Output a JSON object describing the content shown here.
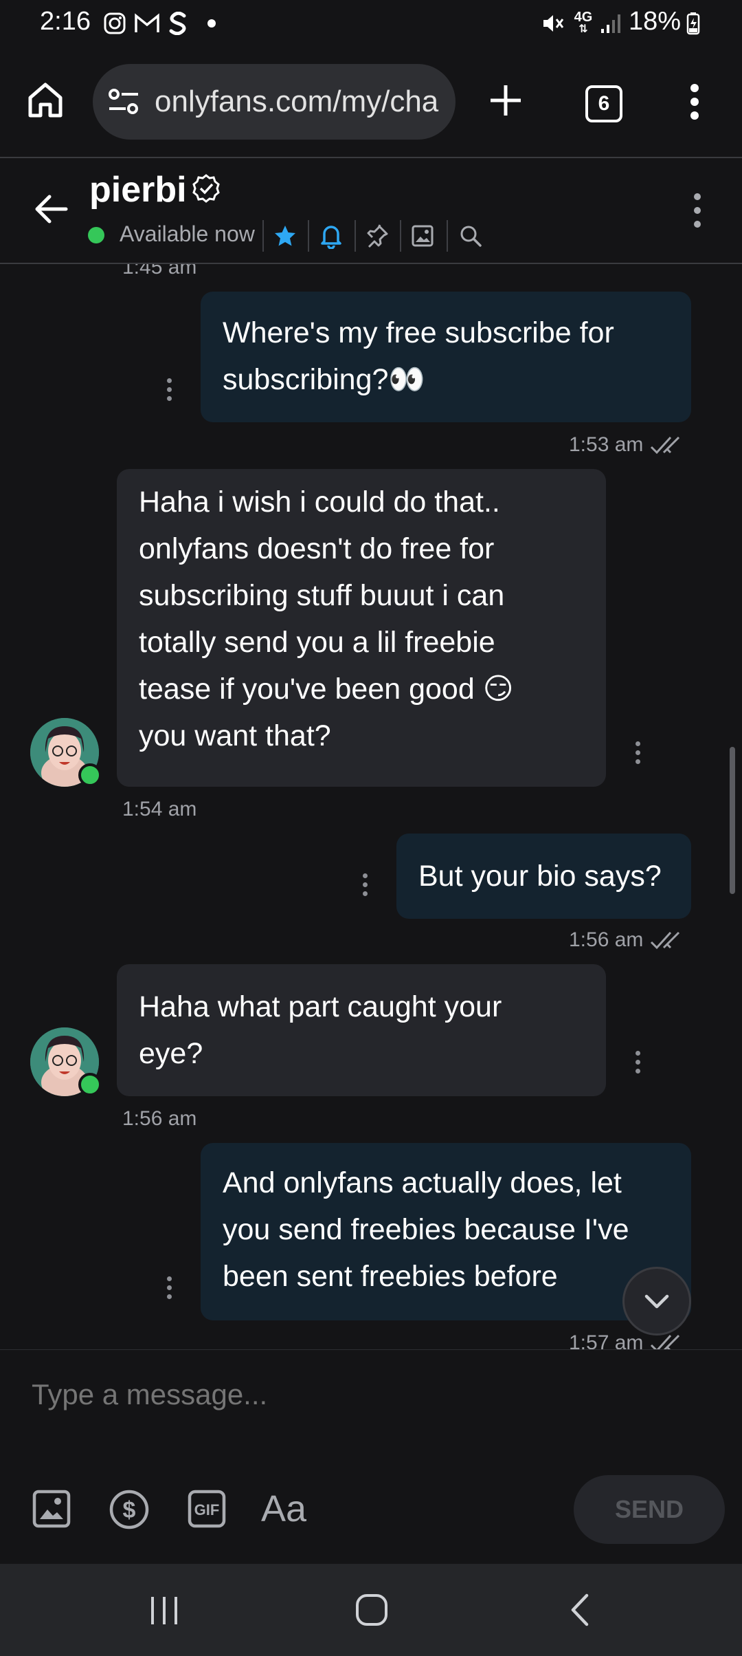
{
  "status_bar": {
    "time": "2:16",
    "battery": "18%",
    "network": "4G"
  },
  "browser": {
    "url": "onlyfans.com/my/cha",
    "tab_count": "6"
  },
  "chat_header": {
    "name": "pierbi",
    "status": "Available now"
  },
  "messages": [
    {
      "side": "me",
      "text_lines": [
        "Where's my free subscribe for",
        "subscribing?👀"
      ],
      "time": "1:53 am",
      "prev_time_partial": "1:45 am"
    },
    {
      "side": "them",
      "text_lines": [
        "Haha i wish i could do that..",
        "onlyfans doesn't do free for",
        "subscribing stuff buuut i can",
        "totally send you a lil freebie",
        "tease if you've been good 😏",
        "you want that?"
      ],
      "time": "1:54 am"
    },
    {
      "side": "me",
      "text_lines": [
        "But your bio says?"
      ],
      "time": "1:56 am"
    },
    {
      "side": "them",
      "text_lines": [
        "Haha what part caught your",
        "eye?"
      ],
      "time": "1:56 am"
    },
    {
      "side": "me",
      "text_lines": [
        "And onlyfans actually does, let",
        "you send freebies because I've",
        "been sent freebies before"
      ],
      "time": "1:57 am"
    }
  ],
  "composer": {
    "placeholder": "Type a message...",
    "text_format_label": "Aa",
    "send_label": "SEND"
  },
  "colors": {
    "background": "#141416",
    "my_bubble": "#14232f",
    "their_bubble": "#25262b",
    "online": "#35c759",
    "accent_blue": "#2ea8f3"
  }
}
